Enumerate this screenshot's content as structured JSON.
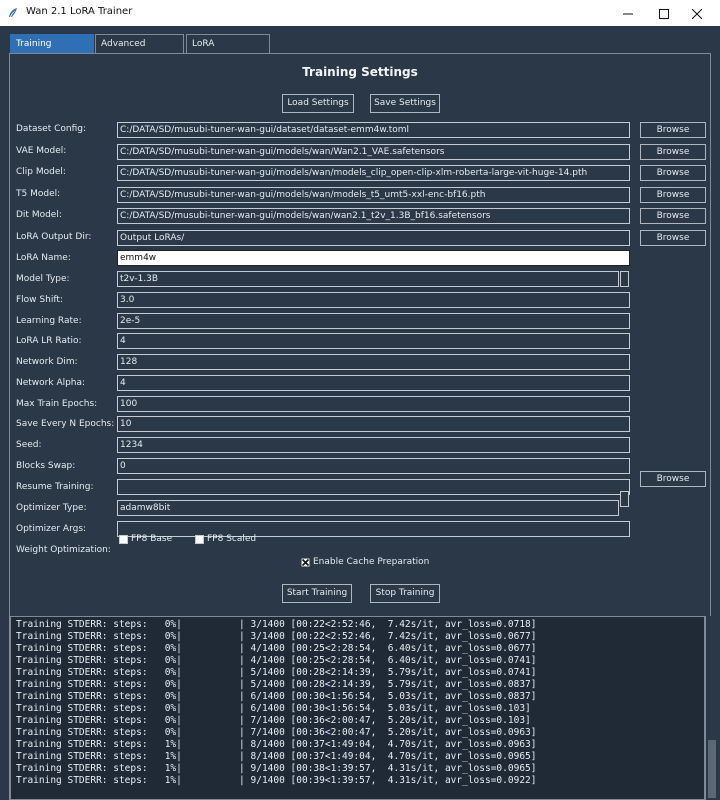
{
  "window": {
    "title": "Wan 2.1 LoRA Trainer"
  },
  "tabs": [
    {
      "label": "Training settings",
      "active": true
    },
    {
      "label": "Advanced settings",
      "active": false
    },
    {
      "label": "LoRA Conversion",
      "active": false
    }
  ],
  "heading": "Training Settings",
  "buttons": {
    "load": "Load Settings",
    "save": "Save Settings",
    "browse": "Browse",
    "start": "Start Training",
    "stop": "Stop Training"
  },
  "fields": [
    {
      "label": "Dataset Config:",
      "value": "C:/DATA/SD/musubi-tuner-wan-gui/dataset/dataset-emm4w.toml",
      "browse": true
    },
    {
      "label": "VAE Model:",
      "value": "C:/DATA/SD/musubi-tuner-wan-gui/models/wan/Wan2.1_VAE.safetensors",
      "browse": true
    },
    {
      "label": "Clip Model:",
      "value": "C:/DATA/SD/musubi-tuner-wan-gui/models/wan/models_clip_open-clip-xlm-roberta-large-vit-huge-14.pth",
      "browse": true
    },
    {
      "label": "T5 Model:",
      "value": "C:/DATA/SD/musubi-tuner-wan-gui/models/wan/models_t5_umt5-xxl-enc-bf16.pth",
      "browse": true
    },
    {
      "label": "Dit Model:",
      "value": "C:/DATA/SD/musubi-tuner-wan-gui/models/wan/wan2.1_t2v_1.3B_bf16.safetensors",
      "browse": true
    },
    {
      "label": "LoRA Output Dir:",
      "value": "Output LoRAs/",
      "browse": true
    },
    {
      "label": "LoRA Name:",
      "value": "emm4w",
      "focused": true
    },
    {
      "label": "Model Type:",
      "value": "t2v-1.3B",
      "dropdown": true
    },
    {
      "label": "Flow Shift:",
      "value": "3.0"
    },
    {
      "label": "Learning Rate:",
      "value": "2e-5"
    },
    {
      "label": "LoRA LR Ratio:",
      "value": "4"
    },
    {
      "label": "Network Dim:",
      "value": "128"
    },
    {
      "label": "Network Alpha:",
      "value": "4"
    },
    {
      "label": "Max Train Epochs:",
      "value": "100"
    },
    {
      "label": "Save Every N Epochs:",
      "value": "10"
    },
    {
      "label": "Seed:",
      "value": "1234"
    },
    {
      "label": "Blocks Swap:",
      "value": "0"
    },
    {
      "label": "Resume Training:",
      "value": "",
      "browse": true
    },
    {
      "label": "Optimizer Type:",
      "value": "adamw8bit",
      "dropdown": true
    },
    {
      "label": "Optimizer Args:",
      "value": ""
    }
  ],
  "weight_opt": {
    "label": "Weight Optimization:",
    "fp8_base": "FP8 Base",
    "fp8_scaled": "FP8 Scaled"
  },
  "cache_prep": {
    "label": "Enable Cache Preparation",
    "checked": true
  },
  "log": [
    "Training STDERR: steps:   0%|          | 3/1400 [00:22<2:52:46,  7.42s/it, avr_loss=0.0718]",
    "Training STDERR: steps:   0%|          | 3/1400 [00:22<2:52:46,  7.42s/it, avr_loss=0.0677]",
    "Training STDERR: steps:   0%|          | 4/1400 [00:25<2:28:54,  6.40s/it, avr_loss=0.0677]",
    "Training STDERR: steps:   0%|          | 4/1400 [00:25<2:28:54,  6.40s/it, avr_loss=0.0741]",
    "Training STDERR: steps:   0%|          | 5/1400 [00:28<2:14:39,  5.79s/it, avr_loss=0.0741]",
    "Training STDERR: steps:   0%|          | 5/1400 [00:28<2:14:39,  5.79s/it, avr_loss=0.0837]",
    "Training STDERR: steps:   0%|          | 6/1400 [00:30<1:56:54,  5.03s/it, avr_loss=0.0837]",
    "Training STDERR: steps:   0%|          | 6/1400 [00:30<1:56:54,  5.03s/it, avr_loss=0.103]",
    "Training STDERR: steps:   0%|          | 7/1400 [00:36<2:00:47,  5.20s/it, avr_loss=0.103]",
    "Training STDERR: steps:   0%|          | 7/1400 [00:36<2:00:47,  5.20s/it, avr_loss=0.0963]",
    "Training STDERR: steps:   1%|          | 8/1400 [00:37<1:49:04,  4.70s/it, avr_loss=0.0963]",
    "Training STDERR: steps:   1%|          | 8/1400 [00:37<1:49:04,  4.70s/it, avr_loss=0.0965]",
    "Training STDERR: steps:   1%|          | 9/1400 [00:38<1:39:57,  4.31s/it, avr_loss=0.0965]",
    "Training STDERR: steps:   1%|          | 9/1400 [00:39<1:39:57,  4.31s/it, avr_loss=0.0922]"
  ]
}
